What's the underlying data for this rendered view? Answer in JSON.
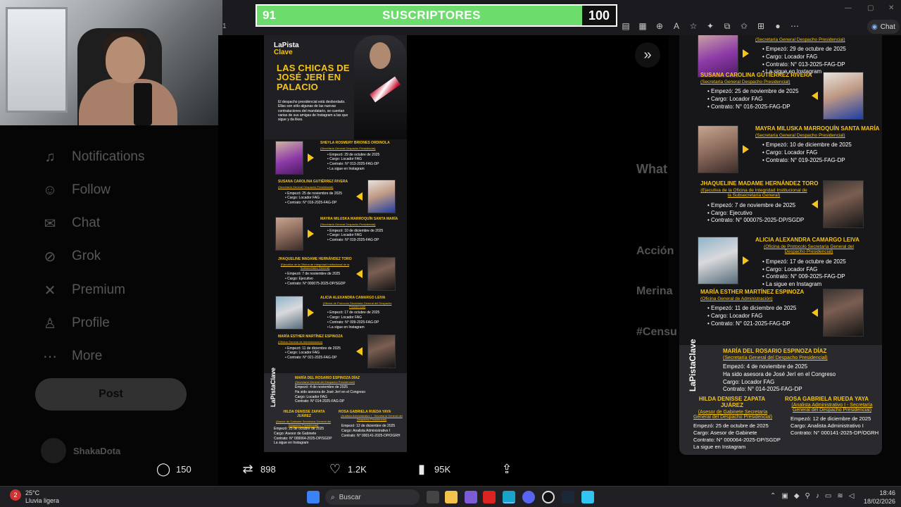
{
  "subscriber_bar": {
    "current": "91",
    "label": "SUSCRIPTORES",
    "goal": "100",
    "progress": 0.91
  },
  "sidebar": {
    "items": [
      {
        "label": "Notifications",
        "icon": "bell-icon"
      },
      {
        "label": "Follow",
        "icon": "follow-icon"
      },
      {
        "label": "Chat",
        "icon": "mail-icon"
      },
      {
        "label": "Grok",
        "icon": "grok-icon"
      },
      {
        "label": "Premium",
        "icon": "x-logo-icon"
      },
      {
        "label": "Profile",
        "icon": "person-icon"
      },
      {
        "label": "More",
        "icon": "more-icon"
      }
    ],
    "post_label": "Post",
    "account_name": "ShakaDota"
  },
  "browser": {
    "chat_label": "Chat",
    "tab_marker": "1"
  },
  "right_panel": {
    "trending_heading": "What",
    "items": [
      "Acción",
      "Merina",
      "#Censu"
    ]
  },
  "poster": {
    "logo_line1": "LaPista",
    "logo_line2": "Clave",
    "title": "LAS CHICAS DE JOSÉ JERÍ EN PALACIO",
    "description": "El despacho presidencial está desbordado. Ellas son sólo algunas de las nuevas contrataciones del mandatario, se cuentan varias de sus amigas de Instagram a las que sigue y da likes.",
    "entries": [
      {
        "name": "SHEYLA ROSMERY BRIONES ORDINOLA",
        "dept": "(Secretaría General Despacho Presidencial)",
        "lines": [
          "Empezó: 29 de octubre de 2025",
          "Cargo: Locador FAG",
          "Contrato: N° 013-2025-FAG-DP",
          "La sigue en Instagram"
        ]
      },
      {
        "name": "SUSANA CAROLINA GUTIÉRREZ RIVERA",
        "dept": "(Secretaría General Despacho Presidencial)",
        "lines": [
          "Empezó: 25 de noviembre de 2025",
          "Cargo: Locador FAG",
          "Contrato: N° 016-2025-FAG-DP"
        ]
      },
      {
        "name": "MAYRA MILUSKA MARROQUÍN SANTA MARÍA",
        "dept": "(Secretaría General Despacho Presidencial)",
        "lines": [
          "Empezó: 10 de diciembre de 2025",
          "Cargo: Locador FAG",
          "Contrato: N° 019-2025-FAG-DP"
        ]
      },
      {
        "name": "JHAQUELINE MADAME HERNÁNDEZ TORO",
        "dept": "(Ejecutiva de la Oficina de Integridad Institucional de la Subsecretaría General)",
        "lines": [
          "Empezó: 7 de noviembre de 2025",
          "Cargo: Ejecutivo",
          "Contrato: N° 000075-2025-DP/SGDP"
        ]
      },
      {
        "name": "ALICIA ALEXANDRA CAMARGO LEIVA",
        "dept": "(Oficina de Protocolo Secretaría General del Despacho Presidencial)",
        "lines": [
          "Empezó: 17 de octubre de 2025",
          "Cargo: Locador FAG",
          "Contrato: N° 009-2025-FAG-DP",
          "La sigue en Instagram"
        ]
      },
      {
        "name": "MARÍA ESTHER MARTÍNEZ ESPINOZA",
        "dept": "(Oficina General de Administración)",
        "lines": [
          "Empezó: 11 de diciembre de 2025",
          "Cargo: Locador FAG",
          "Contrato: N° 021-2025-FAG-DP"
        ]
      }
    ],
    "bottom": {
      "main": {
        "name": "MARÍA DEL ROSARIO ESPINOZA DÍAZ",
        "dept": "(Secretaría General del Despacho Presidencial)",
        "lines": [
          "Empezó: 4 de noviembre de 2025",
          "Ha sido asesora de José Jerí en el Congreso",
          "Cargo: Locador FAG",
          "Contrato: N° 014-2025-FAG-DP"
        ]
      },
      "left": {
        "name": "HILDA DENISSE ZAPATA JUÁREZ",
        "dept": "(Asesor de Gabinete Secretaría General del Despacho Presidencial)",
        "lines": [
          "Empezó: 25 de octubre de 2025",
          "Cargo: Asesor de Gabinete",
          "Contrato: N° 000064-2025-DP/SGDP",
          "La sigue en Instagram"
        ]
      },
      "right": {
        "name": "ROSA GABRIELA RUEDA YAYA",
        "dept": "(Analista Administrativo I - Secretaría General del Despacho Presidencial)",
        "lines": [
          "Empezó: 12 de diciembre de 2025",
          "Cargo: Analista Administrativo I",
          "Contrato: N° 000141-2025-DP/OGRH"
        ]
      }
    }
  },
  "engagement": {
    "replies": "150",
    "reposts": "898",
    "likes": "1.2K",
    "views": "95K"
  },
  "taskbar": {
    "temp": "25°C",
    "weather": "Lluvia ligera",
    "weather_badge": "2",
    "search_placeholder": "Buscar",
    "time": "18:46",
    "date": "18/02/2026"
  },
  "colors": {
    "accent_yellow": "#f5c518",
    "sub_green": "#6cdc6c",
    "poster_bg": "#17171a"
  }
}
